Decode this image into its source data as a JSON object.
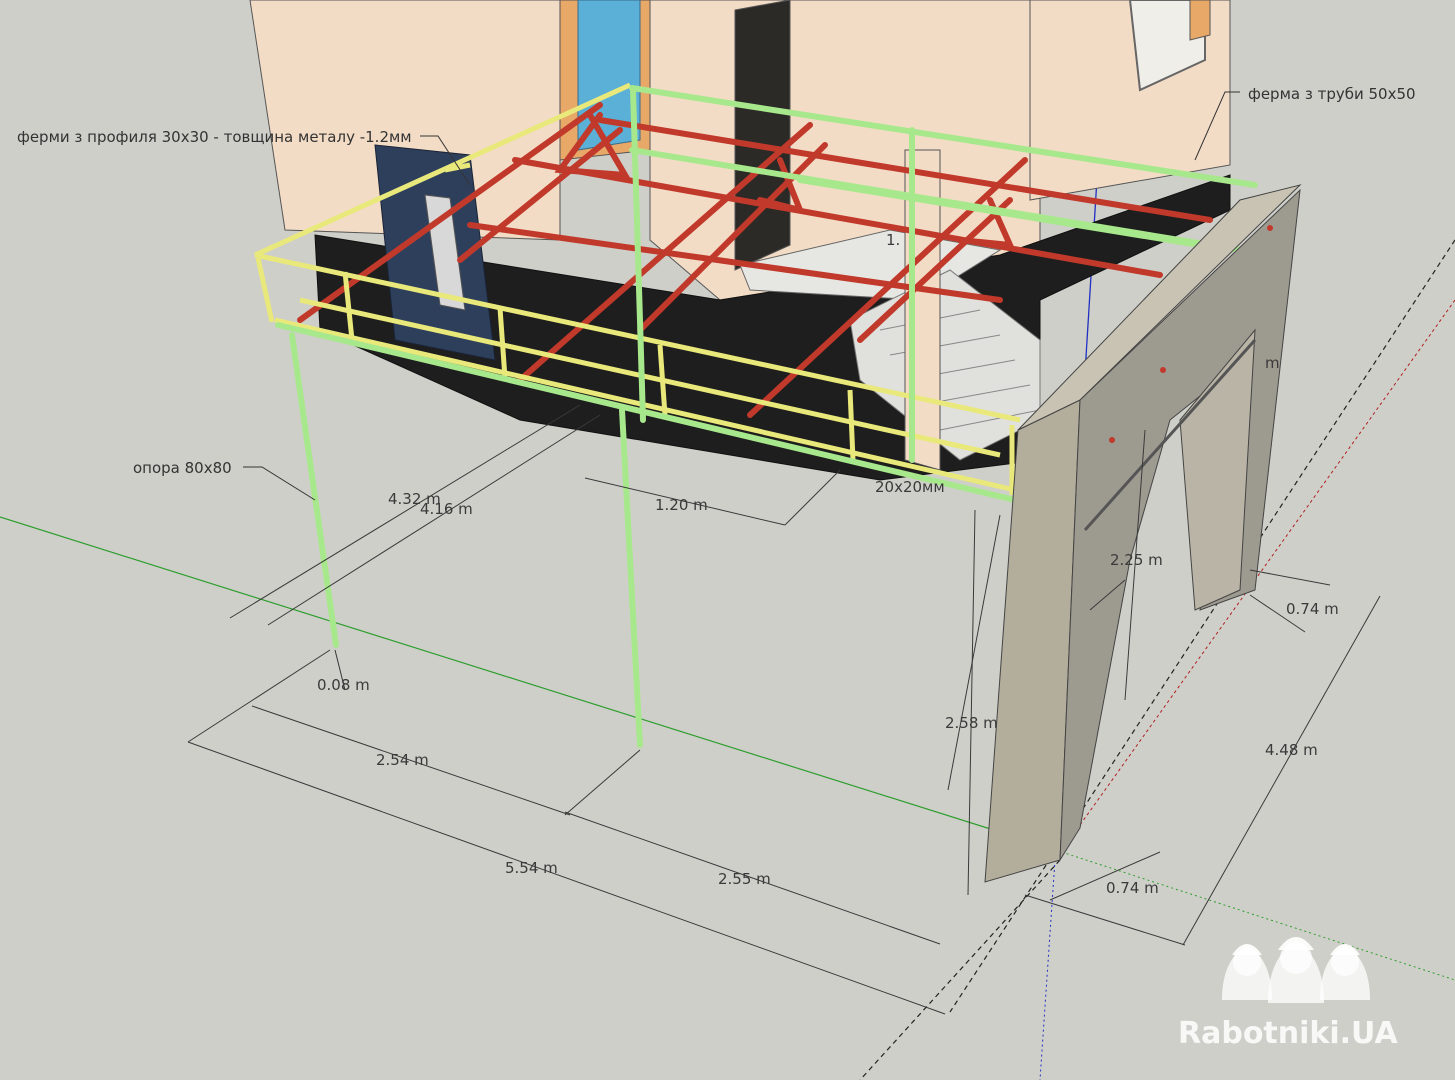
{
  "colors": {
    "background": "#cfcfca",
    "wall": "#f3dcc6",
    "wall_shade": "#e8cdb6",
    "foundation": "#1e1e1e",
    "truss_red": "#c1392b",
    "frame_yellow": "#e9e87a",
    "frame_green": "#a8e88c",
    "door_blue": "#2e3f5c",
    "glass": "#5ab0d6",
    "block_wall": "#a7a395",
    "axis_green": "#2e9e2e",
    "axis_blue": "#2030c0",
    "axis_red": "#b02020"
  },
  "annotations": {
    "truss_profile": "ферми з профиля 30x30 - товщина металу -1.2мм",
    "truss_pipe": "ферма з труби 50x50",
    "support": "опора 80x80",
    "beam_profile": "20x20мм"
  },
  "dimensions": {
    "d_432": "4.32 m",
    "d_416": "4.16 m",
    "d_120": "1.20 m",
    "d_008": "0.08 m",
    "d_254": "2.54 m",
    "d_554": "5.54 m",
    "d_255": "2.55 m",
    "d_258": "2.58 m",
    "d_225": "2.25 m",
    "d_074_top": "0.74 m",
    "d_448": "4.48 m",
    "d_074_bottom": "0.74 m",
    "d_1_partial": "1.",
    "d_m_partial": "m"
  },
  "watermark": {
    "text": "Rabotniki.UA"
  }
}
